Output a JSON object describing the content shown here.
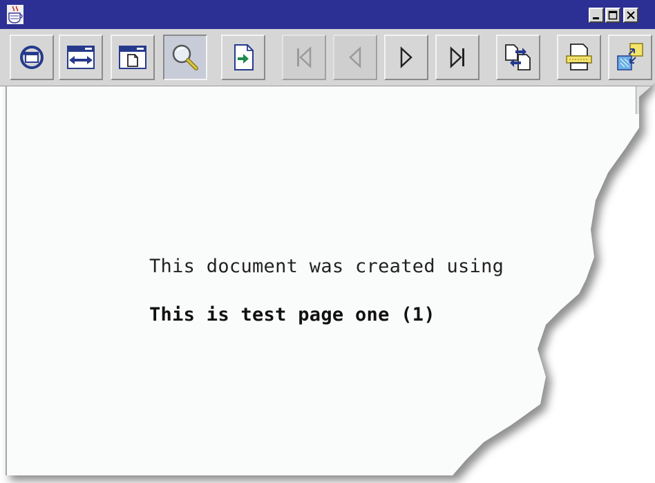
{
  "window": {
    "controls": [
      "minimize",
      "maximize",
      "close"
    ]
  },
  "toolbar": {
    "buttons": [
      {
        "name": "refresh",
        "icon": "refresh-page-icon",
        "state": "normal"
      },
      {
        "name": "fit-width",
        "icon": "fit-width-icon",
        "state": "normal"
      },
      {
        "name": "fit-page",
        "icon": "fit-page-icon",
        "state": "normal"
      },
      {
        "name": "zoom",
        "icon": "magnifier-icon",
        "state": "pressed"
      },
      {
        "name": "go-to-page",
        "icon": "go-to-page-icon",
        "state": "normal"
      },
      {
        "name": "first-page",
        "icon": "first-page-icon",
        "state": "disabled"
      },
      {
        "name": "previous-page",
        "icon": "previous-page-icon",
        "state": "disabled"
      },
      {
        "name": "next-page",
        "icon": "next-page-icon",
        "state": "normal"
      },
      {
        "name": "last-page",
        "icon": "last-page-icon",
        "state": "normal"
      },
      {
        "name": "page-layout",
        "icon": "page-layout-icon",
        "state": "normal"
      },
      {
        "name": "print",
        "icon": "printer-icon",
        "state": "normal"
      },
      {
        "name": "export",
        "icon": "export-icon",
        "state": "normal"
      }
    ]
  },
  "document": {
    "line1": "This document was created using",
    "line2": "This is test page one (1)"
  },
  "colors": {
    "titlebar": "#2c2f93",
    "toolbar": "#d6d6d6",
    "page": "#fafbfb",
    "icon_blue": "#263a8c",
    "arrow_green": "#1f8a4c",
    "note_yellow": "#f3e36b"
  }
}
